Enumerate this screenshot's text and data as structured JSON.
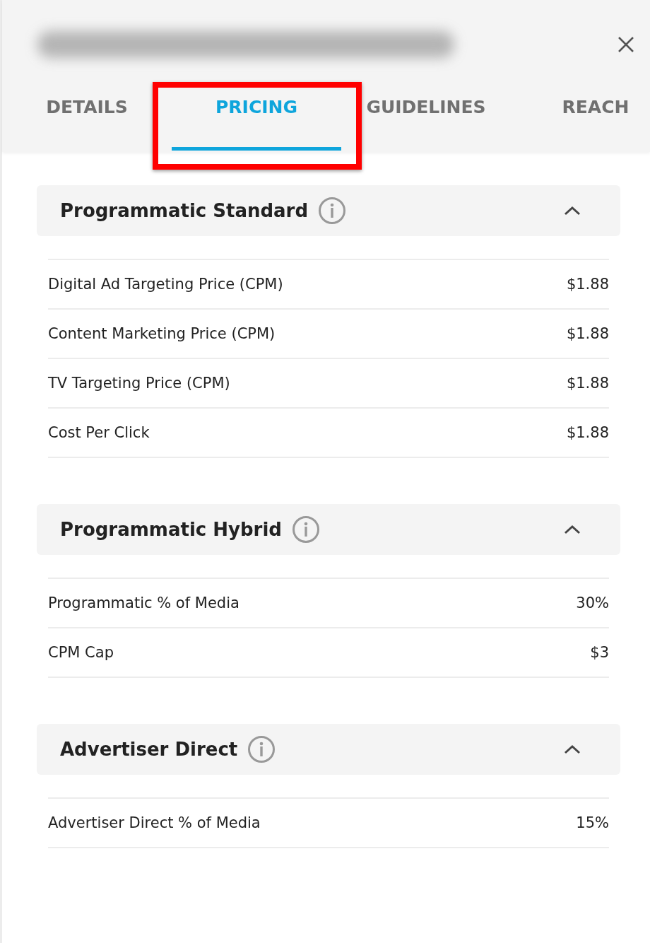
{
  "tabs": [
    {
      "label": "DETAILS",
      "selected": false
    },
    {
      "label": "PRICING",
      "selected": true
    },
    {
      "label": "GUIDELINES",
      "selected": false
    },
    {
      "label": "REACH",
      "selected": false
    }
  ],
  "sections": [
    {
      "title": "Programmatic Standard",
      "expanded": true,
      "rows": [
        {
          "label": "Digital Ad Targeting Price (CPM)",
          "value": "$1.88"
        },
        {
          "label": "Content Marketing Price (CPM)",
          "value": "$1.88"
        },
        {
          "label": "TV Targeting Price (CPM)",
          "value": "$1.88"
        },
        {
          "label": "Cost Per Click",
          "value": "$1.88"
        }
      ]
    },
    {
      "title": "Programmatic Hybrid",
      "expanded": true,
      "rows": [
        {
          "label": "Programmatic % of Media",
          "value": "30%"
        },
        {
          "label": "CPM Cap",
          "value": "$3"
        }
      ]
    },
    {
      "title": "Advertiser Direct",
      "expanded": true,
      "rows": [
        {
          "label": "Advertiser Direct % of Media",
          "value": "15%"
        }
      ]
    }
  ]
}
